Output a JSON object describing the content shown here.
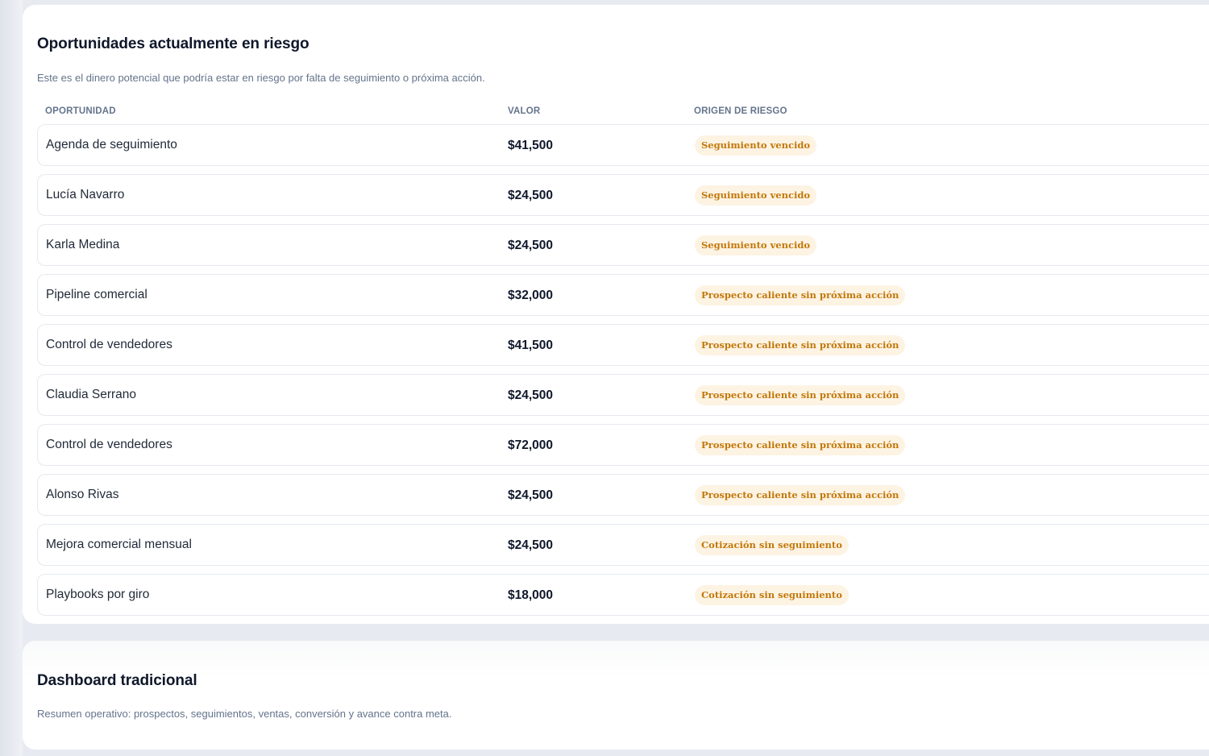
{
  "risk_section": {
    "title": "Oportunidades actualmente en riesgo",
    "subtitle": "Este es el dinero potencial que podría estar en riesgo por falta de seguimiento o próxima acción.",
    "columns": {
      "opportunity": "OPORTUNIDAD",
      "value": "VALOR",
      "origin": "ORIGEN DE RIESGO"
    },
    "rows": [
      {
        "name": "Agenda de seguimiento",
        "value": "$41,500",
        "origin": "Seguimiento vencido"
      },
      {
        "name": "Lucía Navarro",
        "value": "$24,500",
        "origin": "Seguimiento vencido"
      },
      {
        "name": "Karla Medina",
        "value": "$24,500",
        "origin": "Seguimiento vencido"
      },
      {
        "name": "Pipeline comercial",
        "value": "$32,000",
        "origin": "Prospecto caliente sin próxima acción"
      },
      {
        "name": "Control de vendedores",
        "value": "$41,500",
        "origin": "Prospecto caliente sin próxima acción"
      },
      {
        "name": "Claudia Serrano",
        "value": "$24,500",
        "origin": "Prospecto caliente sin próxima acción"
      },
      {
        "name": "Control de vendedores",
        "value": "$72,000",
        "origin": "Prospecto caliente sin próxima acción"
      },
      {
        "name": "Alonso Rivas",
        "value": "$24,500",
        "origin": "Prospecto caliente sin próxima acción"
      },
      {
        "name": "Mejora comercial mensual",
        "value": "$24,500",
        "origin": "Cotización sin seguimiento"
      },
      {
        "name": "Playbooks por giro",
        "value": "$18,000",
        "origin": "Cotización sin seguimiento"
      }
    ]
  },
  "dashboard_section": {
    "title": "Dashboard tradicional",
    "subtitle": "Resumen operativo: prospectos, seguimientos, ventas, conversión y avance contra meta."
  },
  "colors": {
    "page_background": "#e7ebf1",
    "card_background": "#ffffff",
    "badge_background": "#fdf3e3",
    "badge_text": "#c2780a",
    "title_text": "#0f172a",
    "muted_text": "#64748b"
  }
}
